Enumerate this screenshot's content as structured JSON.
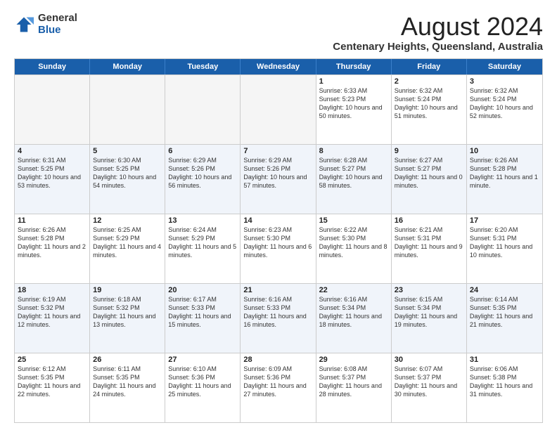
{
  "logo": {
    "general": "General",
    "blue": "Blue"
  },
  "header": {
    "month": "August 2024",
    "subtitle": "Centenary Heights, Queensland, Australia"
  },
  "weekdays": [
    "Sunday",
    "Monday",
    "Tuesday",
    "Wednesday",
    "Thursday",
    "Friday",
    "Saturday"
  ],
  "rows": [
    {
      "cells": [
        {
          "day": "",
          "info": "",
          "empty": true
        },
        {
          "day": "",
          "info": "",
          "empty": true
        },
        {
          "day": "",
          "info": "",
          "empty": true
        },
        {
          "day": "",
          "info": "",
          "empty": true
        },
        {
          "day": "1",
          "info": "Sunrise: 6:33 AM\nSunset: 5:23 PM\nDaylight: 10 hours and 50 minutes."
        },
        {
          "day": "2",
          "info": "Sunrise: 6:32 AM\nSunset: 5:24 PM\nDaylight: 10 hours and 51 minutes."
        },
        {
          "day": "3",
          "info": "Sunrise: 6:32 AM\nSunset: 5:24 PM\nDaylight: 10 hours and 52 minutes."
        }
      ]
    },
    {
      "cells": [
        {
          "day": "4",
          "info": "Sunrise: 6:31 AM\nSunset: 5:25 PM\nDaylight: 10 hours and 53 minutes."
        },
        {
          "day": "5",
          "info": "Sunrise: 6:30 AM\nSunset: 5:25 PM\nDaylight: 10 hours and 54 minutes."
        },
        {
          "day": "6",
          "info": "Sunrise: 6:29 AM\nSunset: 5:26 PM\nDaylight: 10 hours and 56 minutes."
        },
        {
          "day": "7",
          "info": "Sunrise: 6:29 AM\nSunset: 5:26 PM\nDaylight: 10 hours and 57 minutes."
        },
        {
          "day": "8",
          "info": "Sunrise: 6:28 AM\nSunset: 5:27 PM\nDaylight: 10 hours and 58 minutes."
        },
        {
          "day": "9",
          "info": "Sunrise: 6:27 AM\nSunset: 5:27 PM\nDaylight: 11 hours and 0 minutes."
        },
        {
          "day": "10",
          "info": "Sunrise: 6:26 AM\nSunset: 5:28 PM\nDaylight: 11 hours and 1 minute."
        }
      ]
    },
    {
      "cells": [
        {
          "day": "11",
          "info": "Sunrise: 6:26 AM\nSunset: 5:28 PM\nDaylight: 11 hours and 2 minutes."
        },
        {
          "day": "12",
          "info": "Sunrise: 6:25 AM\nSunset: 5:29 PM\nDaylight: 11 hours and 4 minutes."
        },
        {
          "day": "13",
          "info": "Sunrise: 6:24 AM\nSunset: 5:29 PM\nDaylight: 11 hours and 5 minutes."
        },
        {
          "day": "14",
          "info": "Sunrise: 6:23 AM\nSunset: 5:30 PM\nDaylight: 11 hours and 6 minutes."
        },
        {
          "day": "15",
          "info": "Sunrise: 6:22 AM\nSunset: 5:30 PM\nDaylight: 11 hours and 8 minutes."
        },
        {
          "day": "16",
          "info": "Sunrise: 6:21 AM\nSunset: 5:31 PM\nDaylight: 11 hours and 9 minutes."
        },
        {
          "day": "17",
          "info": "Sunrise: 6:20 AM\nSunset: 5:31 PM\nDaylight: 11 hours and 10 minutes."
        }
      ]
    },
    {
      "cells": [
        {
          "day": "18",
          "info": "Sunrise: 6:19 AM\nSunset: 5:32 PM\nDaylight: 11 hours and 12 minutes."
        },
        {
          "day": "19",
          "info": "Sunrise: 6:18 AM\nSunset: 5:32 PM\nDaylight: 11 hours and 13 minutes."
        },
        {
          "day": "20",
          "info": "Sunrise: 6:17 AM\nSunset: 5:33 PM\nDaylight: 11 hours and 15 minutes."
        },
        {
          "day": "21",
          "info": "Sunrise: 6:16 AM\nSunset: 5:33 PM\nDaylight: 11 hours and 16 minutes."
        },
        {
          "day": "22",
          "info": "Sunrise: 6:16 AM\nSunset: 5:34 PM\nDaylight: 11 hours and 18 minutes."
        },
        {
          "day": "23",
          "info": "Sunrise: 6:15 AM\nSunset: 5:34 PM\nDaylight: 11 hours and 19 minutes."
        },
        {
          "day": "24",
          "info": "Sunrise: 6:14 AM\nSunset: 5:35 PM\nDaylight: 11 hours and 21 minutes."
        }
      ]
    },
    {
      "cells": [
        {
          "day": "25",
          "info": "Sunrise: 6:12 AM\nSunset: 5:35 PM\nDaylight: 11 hours and 22 minutes."
        },
        {
          "day": "26",
          "info": "Sunrise: 6:11 AM\nSunset: 5:35 PM\nDaylight: 11 hours and 24 minutes."
        },
        {
          "day": "27",
          "info": "Sunrise: 6:10 AM\nSunset: 5:36 PM\nDaylight: 11 hours and 25 minutes."
        },
        {
          "day": "28",
          "info": "Sunrise: 6:09 AM\nSunset: 5:36 PM\nDaylight: 11 hours and 27 minutes."
        },
        {
          "day": "29",
          "info": "Sunrise: 6:08 AM\nSunset: 5:37 PM\nDaylight: 11 hours and 28 minutes."
        },
        {
          "day": "30",
          "info": "Sunrise: 6:07 AM\nSunset: 5:37 PM\nDaylight: 11 hours and 30 minutes."
        },
        {
          "day": "31",
          "info": "Sunrise: 6:06 AM\nSunset: 5:38 PM\nDaylight: 11 hours and 31 minutes."
        }
      ]
    }
  ]
}
